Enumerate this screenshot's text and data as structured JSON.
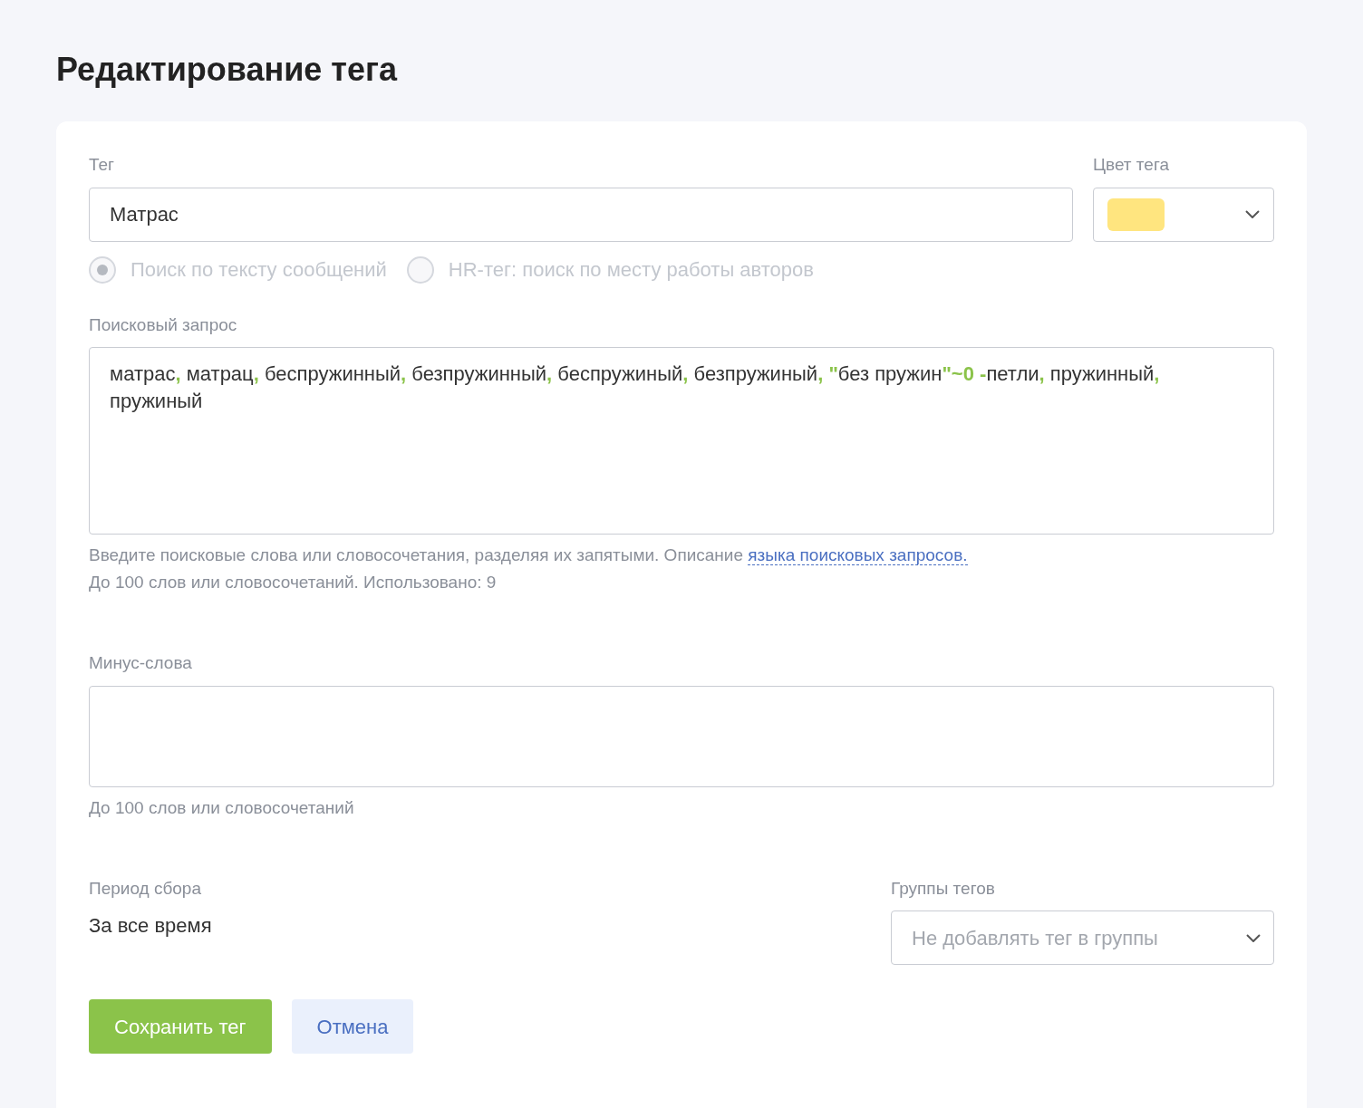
{
  "page_title": "Редактирование тега",
  "tag": {
    "label": "Тег",
    "value": "Матрас"
  },
  "tag_color": {
    "label": "Цвет тега",
    "color": "#ffe57f"
  },
  "search_modes": [
    {
      "label": "Поиск по тексту сообщений",
      "selected": true,
      "disabled": true
    },
    {
      "label": "HR-тег: поиск по месту работы авторов",
      "selected": false,
      "disabled": true
    }
  ],
  "query": {
    "label": "Поисковый запрос",
    "tokens": [
      {
        "kind": "term",
        "text": "матрас"
      },
      {
        "kind": "operator",
        "text": ","
      },
      {
        "kind": "term",
        "text": " матрац"
      },
      {
        "kind": "operator",
        "text": ","
      },
      {
        "kind": "term",
        "text": " беспружинный"
      },
      {
        "kind": "operator",
        "text": ","
      },
      {
        "kind": "term",
        "text": " безпружинный"
      },
      {
        "kind": "operator",
        "text": ","
      },
      {
        "kind": "term",
        "text": " беспружиный"
      },
      {
        "kind": "operator",
        "text": ","
      },
      {
        "kind": "term",
        "text": " безпружиный"
      },
      {
        "kind": "operator",
        "text": ","
      },
      {
        "kind": "operator",
        "text": " \""
      },
      {
        "kind": "term",
        "text": "без пружин"
      },
      {
        "kind": "operator",
        "text": "\"~0 -"
      },
      {
        "kind": "term",
        "text": "петли"
      },
      {
        "kind": "operator",
        "text": ","
      },
      {
        "kind": "term",
        "text": " пружинный"
      },
      {
        "kind": "operator",
        "text": ","
      },
      {
        "kind": "term",
        "text": " пружиный"
      }
    ],
    "hint": "Введите поисковые слова или словосочетания, разделяя их запятыми. Описание",
    "hint_link": "языка поисковых запросов.",
    "counter": "До 100 слов или словосочетаний. Использовано: 9"
  },
  "minus_words": {
    "label": "Минус-слова",
    "hint": "До 100 слов или словосочетаний"
  },
  "period": {
    "label": "Период сбора",
    "value": "За все время"
  },
  "tag_groups": {
    "label": "Группы тегов",
    "placeholder": "Не добавлять тег в группы"
  },
  "buttons": [
    {
      "kind": "primary",
      "label": "Сохранить тег"
    },
    {
      "kind": "secondary",
      "label": "Отмена"
    }
  ]
}
